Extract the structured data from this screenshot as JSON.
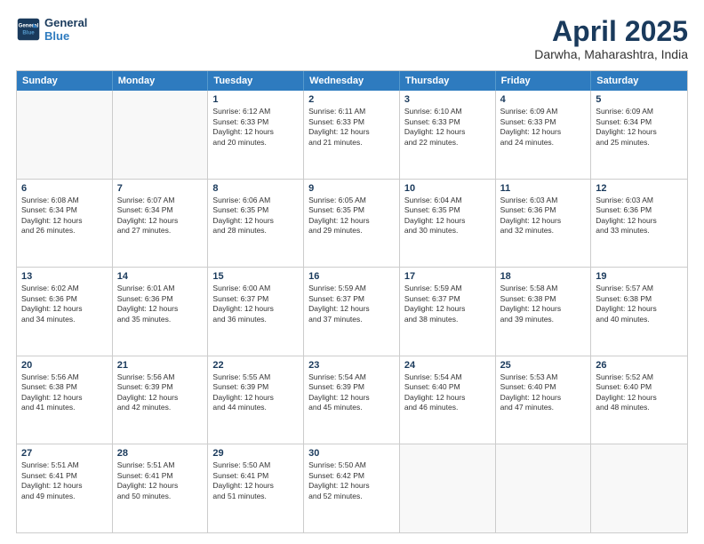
{
  "logo": {
    "line1": "General",
    "line2": "Blue"
  },
  "title": "April 2025",
  "location": "Darwha, Maharashtra, India",
  "days_of_week": [
    "Sunday",
    "Monday",
    "Tuesday",
    "Wednesday",
    "Thursday",
    "Friday",
    "Saturday"
  ],
  "weeks": [
    [
      {
        "day": "",
        "info": "",
        "empty": true
      },
      {
        "day": "",
        "info": "",
        "empty": true
      },
      {
        "day": "1",
        "info": "Sunrise: 6:12 AM\nSunset: 6:33 PM\nDaylight: 12 hours\nand 20 minutes."
      },
      {
        "day": "2",
        "info": "Sunrise: 6:11 AM\nSunset: 6:33 PM\nDaylight: 12 hours\nand 21 minutes."
      },
      {
        "day": "3",
        "info": "Sunrise: 6:10 AM\nSunset: 6:33 PM\nDaylight: 12 hours\nand 22 minutes."
      },
      {
        "day": "4",
        "info": "Sunrise: 6:09 AM\nSunset: 6:33 PM\nDaylight: 12 hours\nand 24 minutes."
      },
      {
        "day": "5",
        "info": "Sunrise: 6:09 AM\nSunset: 6:34 PM\nDaylight: 12 hours\nand 25 minutes."
      }
    ],
    [
      {
        "day": "6",
        "info": "Sunrise: 6:08 AM\nSunset: 6:34 PM\nDaylight: 12 hours\nand 26 minutes."
      },
      {
        "day": "7",
        "info": "Sunrise: 6:07 AM\nSunset: 6:34 PM\nDaylight: 12 hours\nand 27 minutes."
      },
      {
        "day": "8",
        "info": "Sunrise: 6:06 AM\nSunset: 6:35 PM\nDaylight: 12 hours\nand 28 minutes."
      },
      {
        "day": "9",
        "info": "Sunrise: 6:05 AM\nSunset: 6:35 PM\nDaylight: 12 hours\nand 29 minutes."
      },
      {
        "day": "10",
        "info": "Sunrise: 6:04 AM\nSunset: 6:35 PM\nDaylight: 12 hours\nand 30 minutes."
      },
      {
        "day": "11",
        "info": "Sunrise: 6:03 AM\nSunset: 6:36 PM\nDaylight: 12 hours\nand 32 minutes."
      },
      {
        "day": "12",
        "info": "Sunrise: 6:03 AM\nSunset: 6:36 PM\nDaylight: 12 hours\nand 33 minutes."
      }
    ],
    [
      {
        "day": "13",
        "info": "Sunrise: 6:02 AM\nSunset: 6:36 PM\nDaylight: 12 hours\nand 34 minutes."
      },
      {
        "day": "14",
        "info": "Sunrise: 6:01 AM\nSunset: 6:36 PM\nDaylight: 12 hours\nand 35 minutes."
      },
      {
        "day": "15",
        "info": "Sunrise: 6:00 AM\nSunset: 6:37 PM\nDaylight: 12 hours\nand 36 minutes."
      },
      {
        "day": "16",
        "info": "Sunrise: 5:59 AM\nSunset: 6:37 PM\nDaylight: 12 hours\nand 37 minutes."
      },
      {
        "day": "17",
        "info": "Sunrise: 5:59 AM\nSunset: 6:37 PM\nDaylight: 12 hours\nand 38 minutes."
      },
      {
        "day": "18",
        "info": "Sunrise: 5:58 AM\nSunset: 6:38 PM\nDaylight: 12 hours\nand 39 minutes."
      },
      {
        "day": "19",
        "info": "Sunrise: 5:57 AM\nSunset: 6:38 PM\nDaylight: 12 hours\nand 40 minutes."
      }
    ],
    [
      {
        "day": "20",
        "info": "Sunrise: 5:56 AM\nSunset: 6:38 PM\nDaylight: 12 hours\nand 41 minutes."
      },
      {
        "day": "21",
        "info": "Sunrise: 5:56 AM\nSunset: 6:39 PM\nDaylight: 12 hours\nand 42 minutes."
      },
      {
        "day": "22",
        "info": "Sunrise: 5:55 AM\nSunset: 6:39 PM\nDaylight: 12 hours\nand 44 minutes."
      },
      {
        "day": "23",
        "info": "Sunrise: 5:54 AM\nSunset: 6:39 PM\nDaylight: 12 hours\nand 45 minutes."
      },
      {
        "day": "24",
        "info": "Sunrise: 5:54 AM\nSunset: 6:40 PM\nDaylight: 12 hours\nand 46 minutes."
      },
      {
        "day": "25",
        "info": "Sunrise: 5:53 AM\nSunset: 6:40 PM\nDaylight: 12 hours\nand 47 minutes."
      },
      {
        "day": "26",
        "info": "Sunrise: 5:52 AM\nSunset: 6:40 PM\nDaylight: 12 hours\nand 48 minutes."
      }
    ],
    [
      {
        "day": "27",
        "info": "Sunrise: 5:51 AM\nSunset: 6:41 PM\nDaylight: 12 hours\nand 49 minutes."
      },
      {
        "day": "28",
        "info": "Sunrise: 5:51 AM\nSunset: 6:41 PM\nDaylight: 12 hours\nand 50 minutes."
      },
      {
        "day": "29",
        "info": "Sunrise: 5:50 AM\nSunset: 6:41 PM\nDaylight: 12 hours\nand 51 minutes."
      },
      {
        "day": "30",
        "info": "Sunrise: 5:50 AM\nSunset: 6:42 PM\nDaylight: 12 hours\nand 52 minutes."
      },
      {
        "day": "",
        "info": "",
        "empty": true
      },
      {
        "day": "",
        "info": "",
        "empty": true
      },
      {
        "day": "",
        "info": "",
        "empty": true
      }
    ]
  ]
}
